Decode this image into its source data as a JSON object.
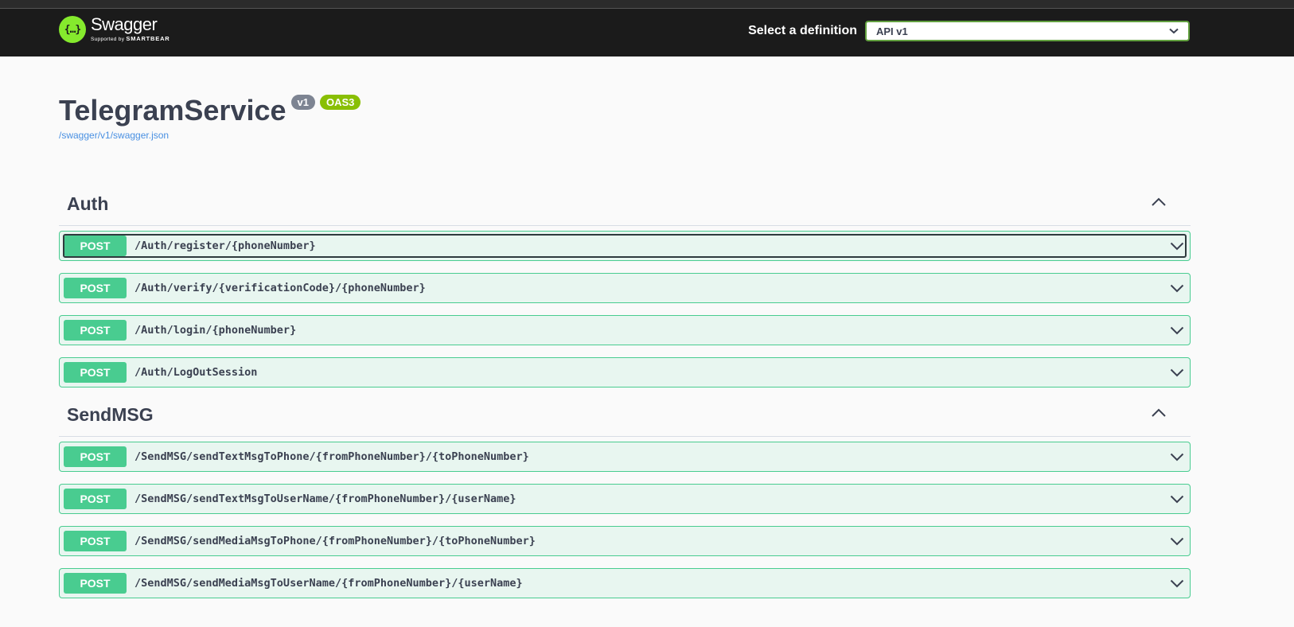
{
  "topbar": {
    "logo_glyph": "{…}",
    "logo_title": "Swagger",
    "logo_sub_prefix": "Supported by",
    "logo_sub_brand": "SMARTBEAR",
    "definition_label": "Select a definition",
    "definition_value": "API v1"
  },
  "info": {
    "title": "TelegramService",
    "version_badge": "v1",
    "oas_badge": "OAS3",
    "spec_link": "/swagger/v1/swagger.json"
  },
  "tags": [
    {
      "name": "Auth",
      "operations": [
        {
          "method": "POST",
          "path": "/Auth/register/{phoneNumber}"
        },
        {
          "method": "POST",
          "path": "/Auth/verify/{verificationCode}/{phoneNumber}"
        },
        {
          "method": "POST",
          "path": "/Auth/login/{phoneNumber}"
        },
        {
          "method": "POST",
          "path": "/Auth/LogOutSession"
        }
      ]
    },
    {
      "name": "SendMSG",
      "operations": [
        {
          "method": "POST",
          "path": "/SendMSG/sendTextMsgToPhone/{fromPhoneNumber}/{toPhoneNumber}"
        },
        {
          "method": "POST",
          "path": "/SendMSG/sendTextMsgToUserName/{fromPhoneNumber}/{userName}"
        },
        {
          "method": "POST",
          "path": "/SendMSG/sendMediaMsgToPhone/{fromPhoneNumber}/{toPhoneNumber}"
        },
        {
          "method": "POST",
          "path": "/SendMSG/sendMediaMsgToUserName/{fromPhoneNumber}/{userName}"
        }
      ]
    }
  ],
  "colors": {
    "post": "#49cc90",
    "post_bg": "#e8f6f0",
    "topbar": "#1b1b1b",
    "accent_green": "#85ea2d",
    "oas_badge": "#89bf04",
    "version_badge": "#7d8492",
    "link": "#4990e2"
  },
  "icons": {
    "logo": "swagger-logo-icon",
    "select_caret": "chevron-down-icon",
    "section_toggle": "chevron-up-icon",
    "operation_toggle": "chevron-down-icon"
  }
}
